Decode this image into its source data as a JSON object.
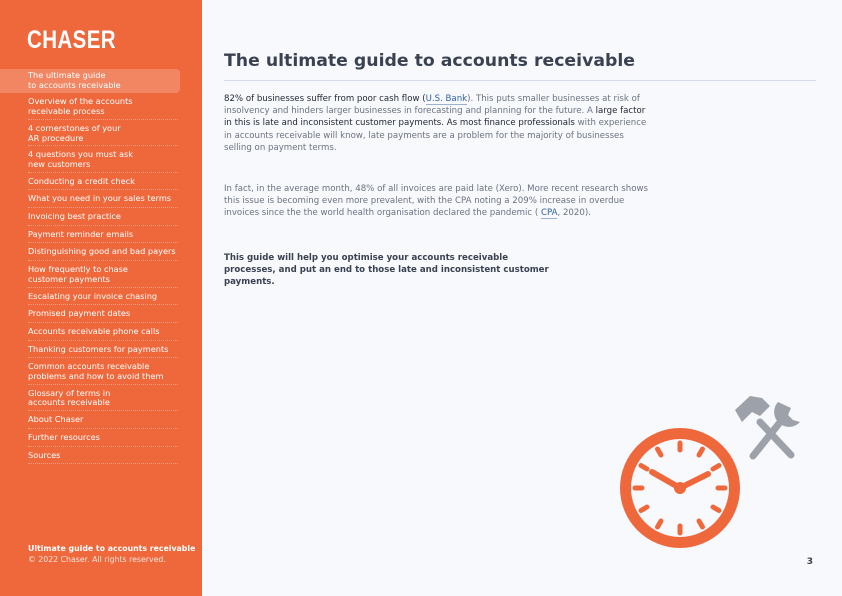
{
  "sidebar": {
    "logo": "CHASER",
    "items": [
      {
        "label": "The ultimate guide\nto accounts receivable",
        "active": true
      },
      {
        "label": "Overview of the accounts\nreceivable process"
      },
      {
        "label": "4 cornerstones of your\nAR procedure"
      },
      {
        "label": "4 questions you must ask\nnew customers"
      },
      {
        "label": "Conducting a credit check"
      },
      {
        "label": "What you need in your sales terms"
      },
      {
        "label": "Invoicing best practice"
      },
      {
        "label": "Payment reminder emails"
      },
      {
        "label": "Distinguishing good and bad payers"
      },
      {
        "label": "How frequently to chase\ncustomer payments"
      },
      {
        "label": "Escalating your invoice chasing"
      },
      {
        "label": "Promised payment dates"
      },
      {
        "label": "Accounts receivable phone calls"
      },
      {
        "label": "Thanking customers for payments"
      },
      {
        "label": "Common accounts receivable\nproblems and how to avoid them"
      },
      {
        "label": "Glossary of terms in\naccounts receivable"
      },
      {
        "label": "About Chaser"
      },
      {
        "label": "Further resources"
      },
      {
        "label": "Sources"
      }
    ],
    "footer": {
      "title": "Ultimate guide to accounts receivable",
      "copyright": "© 2022 Chaser. All rights reserved."
    }
  },
  "main": {
    "title": "The ultimate guide to accounts receivable",
    "p1": {
      "s1": "82% of businesses suffer from poor cash flow (",
      "link1": "U.S. Bank",
      "s2": "). This puts smaller businesses at risk of insolvency and hinders larger businesses in forecasting and planning for the future. A ",
      "s3": "large factor in this is late and inconsistent customer payments. As most finance professionals",
      "s4": " with experience in accounts receivable will know, late payments are a problem for the majority of businesses selling on payment terms."
    },
    "p2": {
      "s1": "In fact, in the average month, 48% of all invoices are paid late (Xero). More recent research shows this issue is becoming even more prevalent, with the CPA noting a 209% increase in overdue invoices since the the world health organisation declared the pandemic ( ",
      "link1": "CPA",
      "s2": ", 2020)."
    },
    "p3": "This guide will help you optimise your accounts receivable processes, and put an end to those late and inconsistent customer payments.",
    "page_number": "3"
  },
  "colors": {
    "brand_orange": "#ef683c",
    "tool_gray": "#9ca1aa",
    "link_blue": "#2f5fa8"
  },
  "icons": {
    "illustration_clock": "clock-icon",
    "illustration_tools": "hammer-wrench-icon"
  }
}
